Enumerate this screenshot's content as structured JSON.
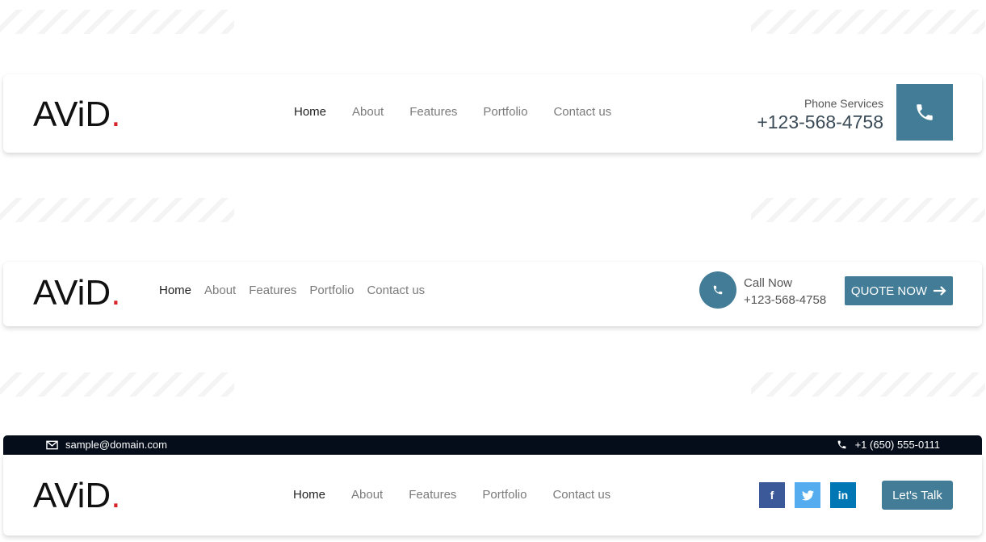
{
  "colors": {
    "accent": "#427c96",
    "logo_dot": "#d7262b",
    "topbar": "#050d1a",
    "facebook": "#3b5998",
    "twitter": "#55acee",
    "linkedin": "#0077b5"
  },
  "logo": {
    "text": "AViD",
    "dot": "."
  },
  "header1": {
    "nav": [
      "Home",
      "About",
      "Features",
      "Portfolio",
      "Contact us"
    ],
    "phone_label": "Phone Services",
    "phone_number": "+123-568-4758",
    "phone_icon": "phone-icon"
  },
  "header2": {
    "nav": [
      "Home",
      "About",
      "Features",
      "Portfolio",
      "Contact us"
    ],
    "call_label": "Call Now",
    "call_number": "+123-568-4758",
    "quote_button": "QUOTE NOW",
    "quote_icon": "arrow-right-icon"
  },
  "header3": {
    "topbar_email": "sample@domain.com",
    "topbar_phone": "+1 (650) 555-0111",
    "nav": [
      "Home",
      "About",
      "Features",
      "Portfolio",
      "Contact us"
    ],
    "social": [
      "f",
      "t",
      "in"
    ],
    "cta_button": "Let's Talk"
  }
}
